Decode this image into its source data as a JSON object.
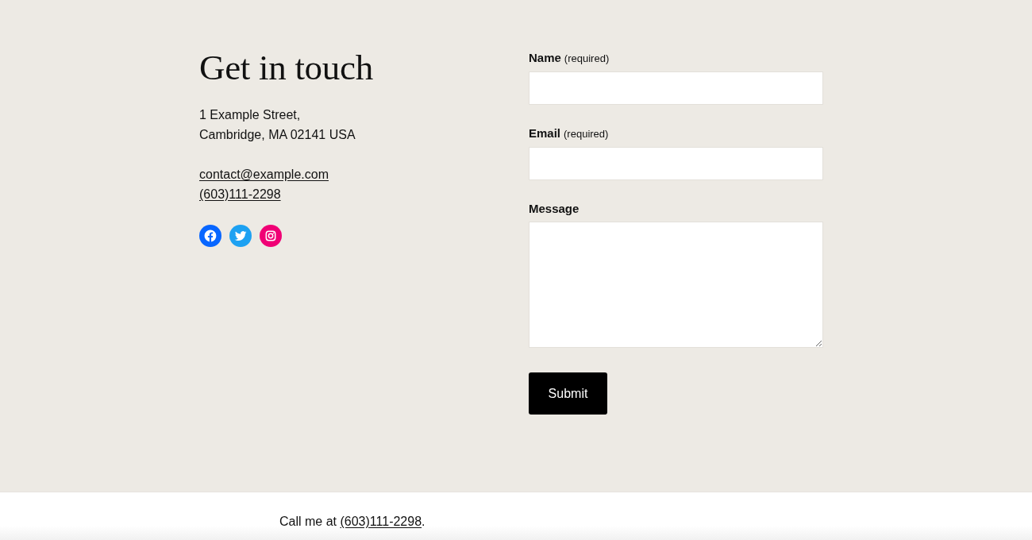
{
  "contact": {
    "heading": "Get in touch",
    "address_lines": [
      "1 Example Street,",
      "Cambridge, MA 02141 USA"
    ],
    "links": [
      "contact@example.com",
      "(603)111-2298"
    ],
    "social_icons": [
      {
        "kind": "facebook",
        "color": "#0866ff"
      },
      {
        "kind": "twitter",
        "color": "#1da1f2"
      },
      {
        "kind": "instagram",
        "color": "#f00075"
      }
    ]
  },
  "form": {
    "fields": [
      {
        "kind": "input",
        "label": "Name",
        "note": "(required)"
      },
      {
        "kind": "input",
        "label": "Email",
        "note": "(required)"
      },
      {
        "kind": "textarea",
        "label": "Message"
      }
    ],
    "submit": "Submit"
  },
  "footer": {
    "text_before": "Call me at",
    "link": "(603)111-2298",
    "text_after": "."
  }
}
